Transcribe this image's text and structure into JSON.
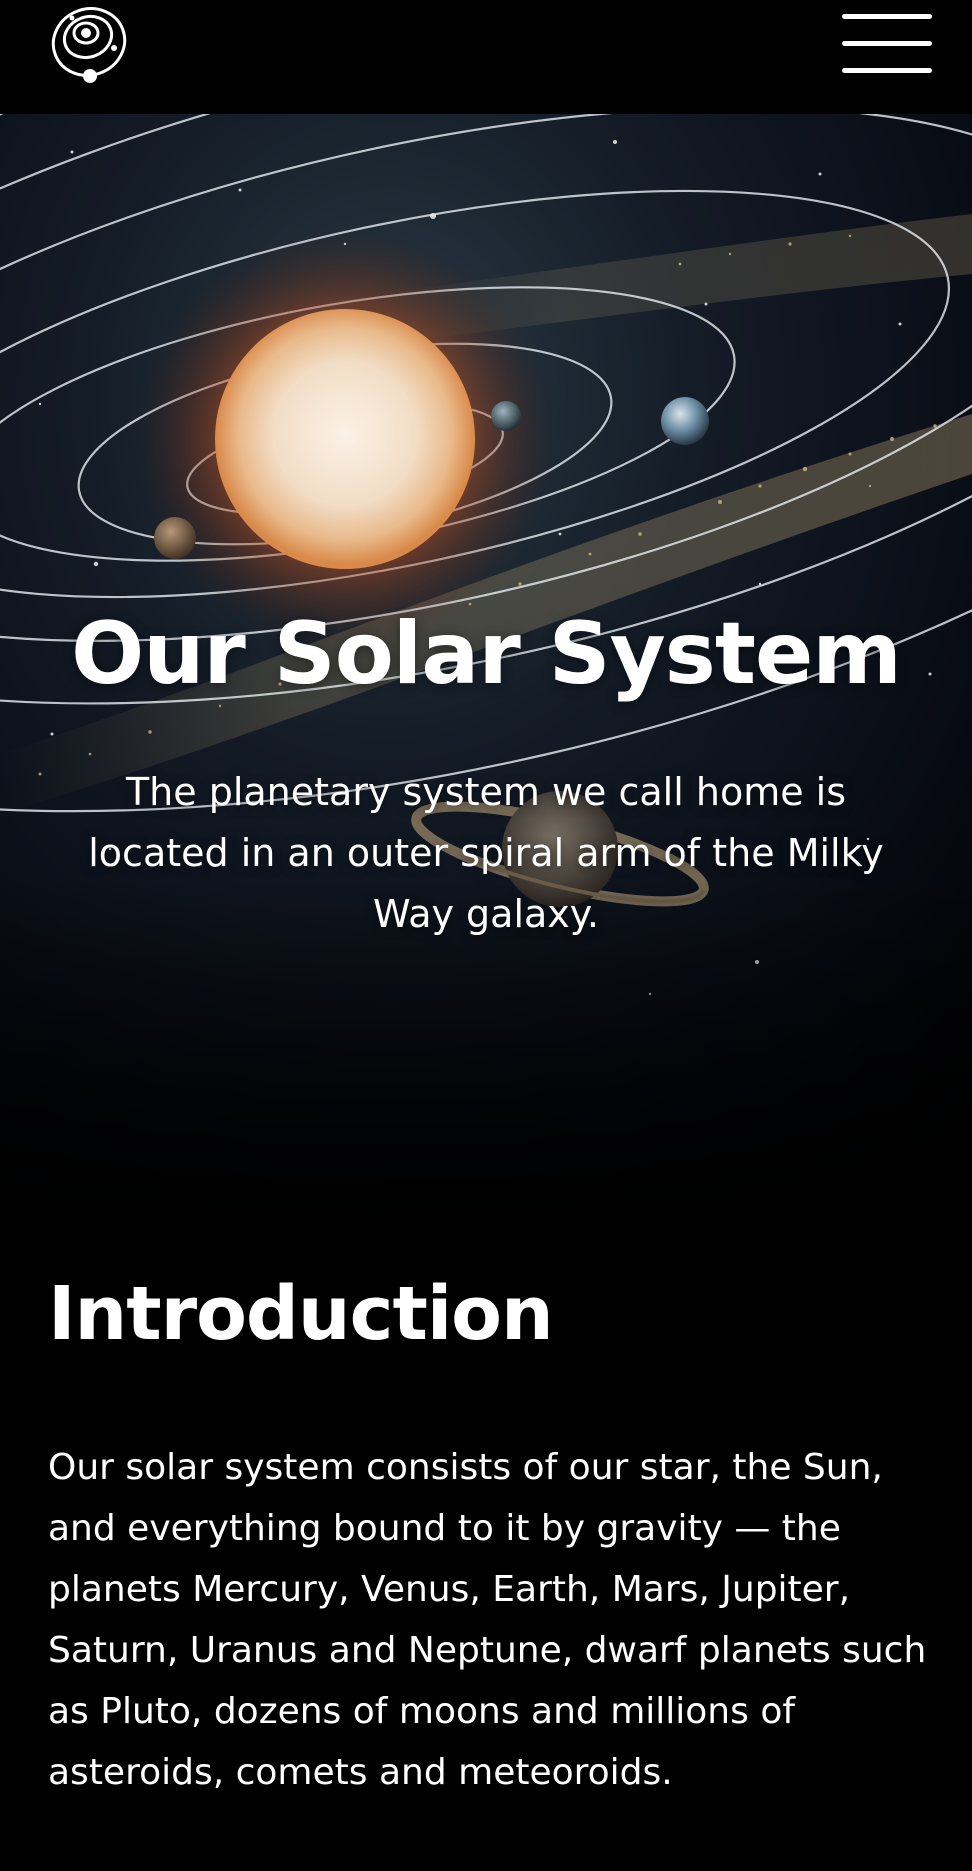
{
  "header": {
    "logo_icon": "solar-system-orbit-logo",
    "menu_icon": "hamburger-menu-icon"
  },
  "hero": {
    "title": "Our Solar System",
    "subtitle": "The planetary system we call home is located in an outer spiral arm of the Milky Way galaxy.",
    "image_subject": "sun-with-orbiting-planets-and-asteroid-belt"
  },
  "introduction": {
    "heading": "Introduction",
    "body": "Our solar system consists of our star, the Sun, and everything bound to it by gravity — the planets Mercury, Venus, Earth, Mars, Jupiter, Saturn, Uranus and Neptune, dwarf planets such as Pluto, dozens of moons and millions of asteroids, comets and meteoroids."
  },
  "colors": {
    "background": "#000000",
    "text": "#ffffff",
    "sun_glow": "#e8772e",
    "space": "#0b1220"
  }
}
